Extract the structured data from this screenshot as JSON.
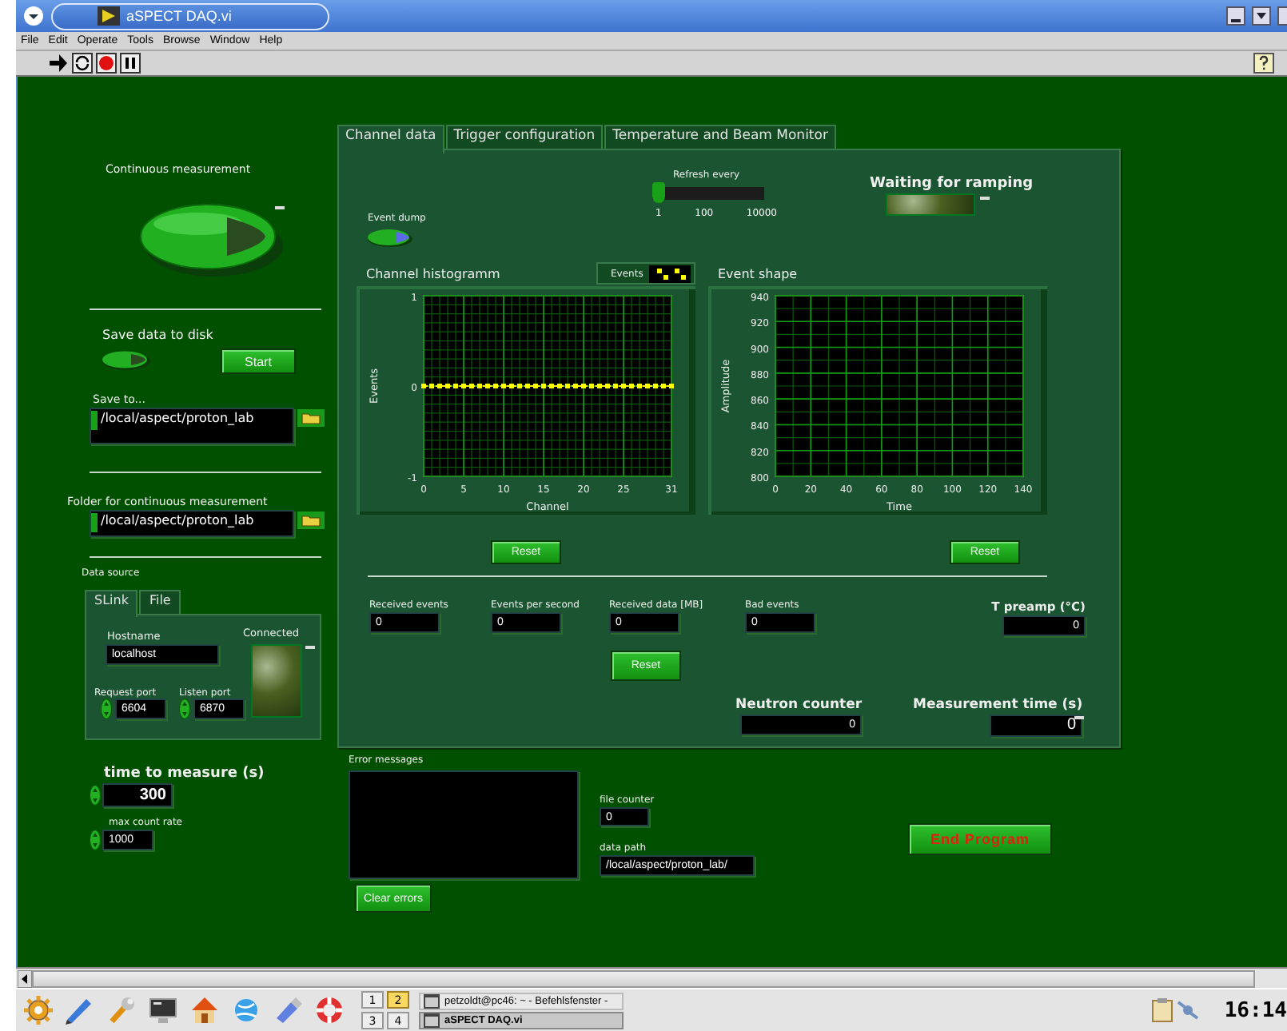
{
  "window": {
    "title": "aSPECT DAQ.vi"
  },
  "menu": [
    "File",
    "Edit",
    "Operate",
    "Tools",
    "Browse",
    "Window",
    "Help"
  ],
  "continuous_measurement": {
    "label": "Continuous measurement",
    "on": false
  },
  "save_data": {
    "label": "Save data to disk",
    "on": false,
    "button": "Start"
  },
  "save_to": {
    "label": "Save to...",
    "value": "/local/aspect/proton_lab"
  },
  "folder": {
    "label": "Folder for continuous measurement",
    "value": "/local/aspect/proton_lab"
  },
  "data_source": {
    "label": "Data source",
    "tabs": [
      {
        "label": "SLink",
        "selected": true
      },
      {
        "label": "File",
        "selected": false
      }
    ],
    "hostname": {
      "label": "Hostname",
      "value": "localhost"
    },
    "request_port": {
      "label": "Request port",
      "value": "6604"
    },
    "listen_port": {
      "label": "Listen port",
      "value": "6870"
    },
    "connected": {
      "label": "Connected",
      "on": false
    }
  },
  "time_to_measure": {
    "label": "time to measure (s)",
    "value": "300"
  },
  "max_count_rate": {
    "label": "max count rate",
    "value": "1000"
  },
  "tabs": [
    {
      "label": "Channel data",
      "selected": true
    },
    {
      "label": "Trigger configuration",
      "selected": false
    },
    {
      "label": "Temperature and Beam Monitor",
      "selected": false
    }
  ],
  "refresh": {
    "label": "Refresh every",
    "level": 0,
    "ticks": [
      "1",
      "100",
      "10000"
    ]
  },
  "waiting_for_ramping": {
    "label": "Waiting for ramping",
    "on": false
  },
  "event_dump": {
    "label": "Event dump",
    "on": false
  },
  "histogram": {
    "chart_data": {
      "type": "line",
      "title": "Channel histogramm",
      "xlabel": "Channel",
      "ylabel": "Events",
      "x": [
        0,
        1,
        2,
        3,
        4,
        5,
        6,
        7,
        8,
        9,
        10,
        11,
        12,
        13,
        14,
        15,
        16,
        17,
        18,
        19,
        20,
        21,
        22,
        23,
        24,
        25,
        26,
        27,
        28,
        29,
        30,
        31
      ],
      "grid": true,
      "series": [
        {
          "name": "Events",
          "color": "#ffff00",
          "line_style": "dashed",
          "values": [
            0,
            0,
            0,
            0,
            0,
            0,
            0,
            0,
            0,
            0,
            0,
            0,
            0,
            0,
            0,
            0,
            0,
            0,
            0,
            0,
            0,
            0,
            0,
            0,
            0,
            0,
            0,
            0,
            0,
            0,
            0,
            0
          ]
        }
      ],
      "xlim": [
        0,
        31
      ],
      "ylim": [
        -1,
        1
      ],
      "xticks": [
        0,
        5,
        10,
        15,
        20,
        25,
        31
      ],
      "yticks": [
        -1,
        0,
        1
      ]
    }
  },
  "event_shape": {
    "chart_data": {
      "type": "line",
      "title": "Event shape",
      "xlabel": "Time",
      "ylabel": "Amplitude",
      "grid": true,
      "xlim": [
        0,
        140
      ],
      "ylim": [
        800,
        940
      ],
      "xticks": [
        0,
        20,
        40,
        60,
        80,
        100,
        120,
        140
      ],
      "yticks": [
        800,
        820,
        840,
        860,
        880,
        900,
        920,
        940
      ]
    }
  },
  "reset_buttons": [
    "Reset",
    "Reset"
  ],
  "counters": [
    {
      "label": "Received events",
      "value": "0"
    },
    {
      "label": "Events per second",
      "value": "0"
    },
    {
      "label": "Received data [MB]",
      "value": "0"
    },
    {
      "label": "Bad events",
      "value": "0"
    }
  ],
  "t_preamp": {
    "label": "T preamp (°C)",
    "value": "0"
  },
  "counters_reset": "Reset",
  "neutron_counter": {
    "label": "Neutron counter",
    "value": "0"
  },
  "measurement_time": {
    "label": "Measurement time (s)",
    "value": "0"
  },
  "error_messages": {
    "label": "Error messages",
    "button": "Clear errors"
  },
  "file_counter": {
    "label": "file counter",
    "value": "0"
  },
  "data_path": {
    "label": "data path",
    "value": "/local/aspect/proton_lab/"
  },
  "end_button": "End Program",
  "taskbar": {
    "desktops": [
      {
        "label": "1",
        "selected": false
      },
      {
        "label": "2",
        "selected": true
      },
      {
        "label": "3",
        "selected": false
      },
      {
        "label": "4",
        "selected": false
      }
    ],
    "tasks": [
      {
        "label": "petzoldt@pc46: ~ - Befehlsfenster -",
        "selected": false
      },
      {
        "label": "aSPECT DAQ.vi",
        "selected": true
      }
    ],
    "clock": "16:14"
  }
}
